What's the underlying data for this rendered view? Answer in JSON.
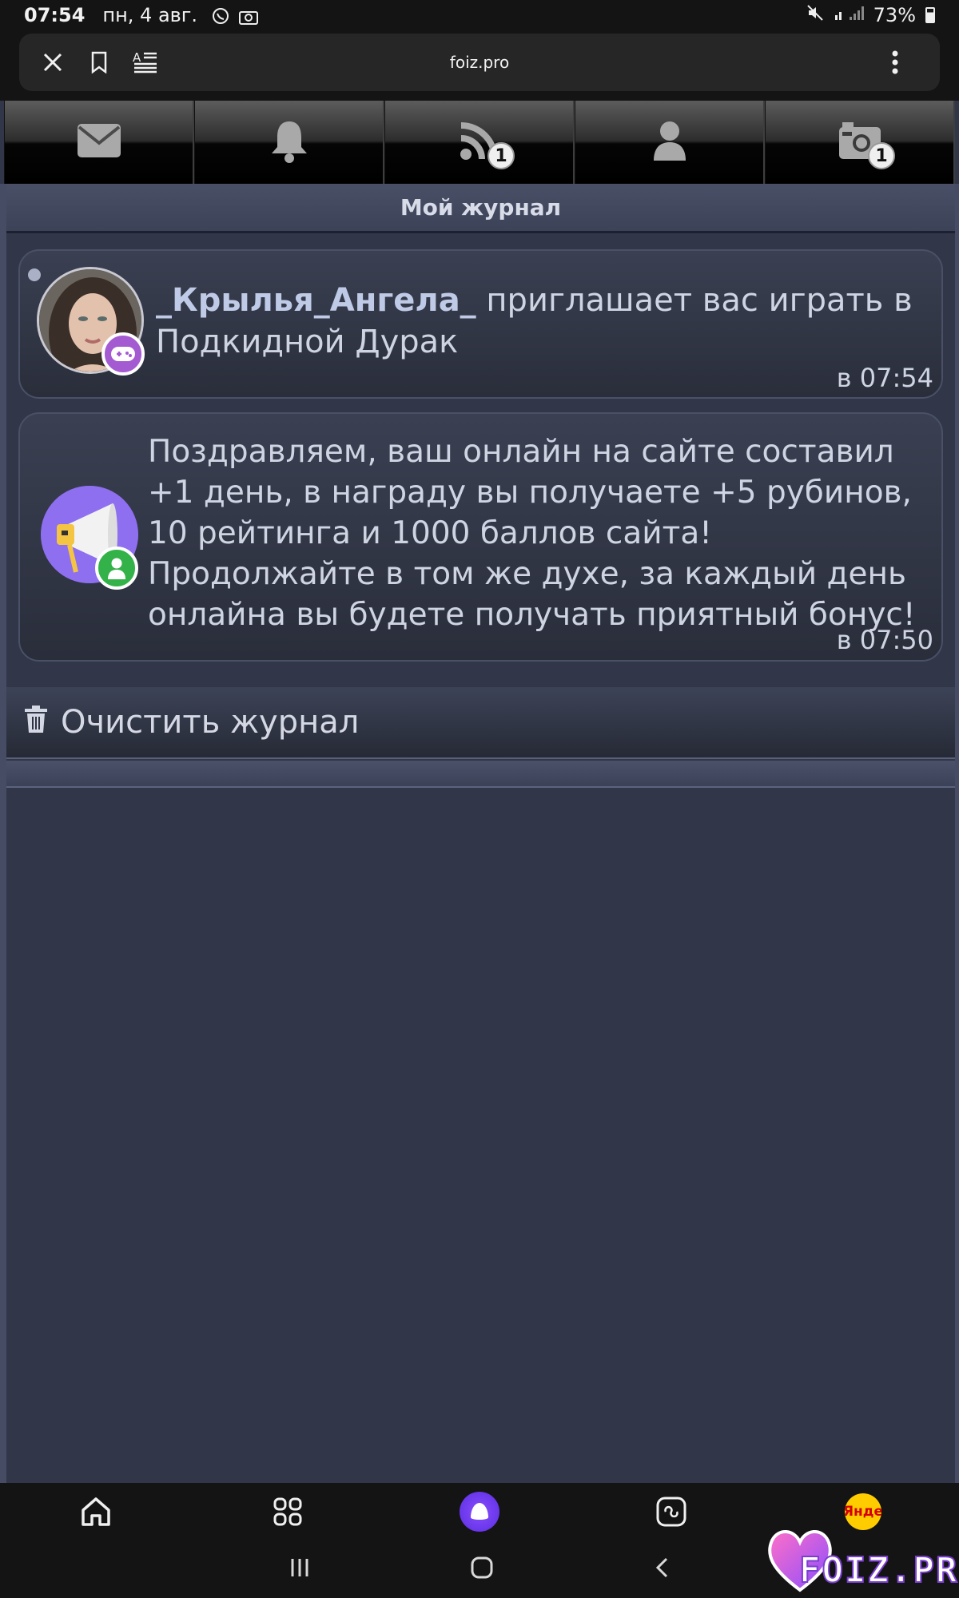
{
  "status_bar": {
    "time": "07:54",
    "date": "пн, 4 авг.",
    "battery": "73%"
  },
  "browser": {
    "url": "foiz.pro"
  },
  "top_nav": {
    "items": [
      {
        "icon": "envelope-icon",
        "badge": null
      },
      {
        "icon": "bell-icon",
        "badge": null
      },
      {
        "icon": "rss-icon",
        "badge": "1"
      },
      {
        "icon": "user-icon",
        "badge": null
      },
      {
        "icon": "camera-icon",
        "badge": "1"
      }
    ]
  },
  "journal": {
    "title": "Мой журнал",
    "entries": [
      {
        "username": "_Крылья_Ангела_",
        "text": " приглашает вас играть в Подкидной Дурак",
        "time": "в 07:54",
        "badge_icon": "gamepad-icon"
      },
      {
        "text": "Поздравляем, ваш онлайн на сайте составил +1 день, в награду вы получаете +5 рубинов, 10 рейтинга и 1000 баллов сайта! Продолжайте в том же духе, за каждый день онлайна вы будете получать приятный бонус!",
        "time": "в 07:50",
        "badge_icon": "user-icon"
      }
    ],
    "clear_label": "Очистить журнал"
  },
  "bottom_nav": {
    "yandex_label": "Янде"
  },
  "watermark": {
    "text": "FOIZ.PRO"
  },
  "colors": {
    "background": "#313749",
    "card": "#2a2e3b",
    "accent_purple": "#7b3fd0",
    "badge_green": "#33b249"
  }
}
